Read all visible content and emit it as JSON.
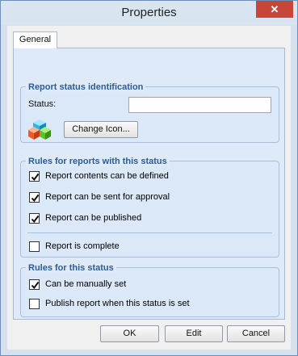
{
  "window": {
    "title": "Properties",
    "close_glyph": "✕"
  },
  "tabs": [
    {
      "label": "General",
      "selected": true
    }
  ],
  "group_identification": {
    "title": "Report status identification",
    "status_label": "Status:",
    "status_value": "",
    "icon": "colored-cubes-icon",
    "change_icon_label": "Change Icon..."
  },
  "group_report_rules": {
    "title": "Rules for reports with this status",
    "items": [
      {
        "label": "Report contents can be defined",
        "checked": true
      },
      {
        "label": "Report can be sent for approval",
        "checked": true
      },
      {
        "label": "Report can be published",
        "checked": true
      },
      {
        "label": "Report is complete",
        "checked": false
      }
    ]
  },
  "group_status_rules": {
    "title": "Rules for this status",
    "items": [
      {
        "label": "Can be manually set",
        "checked": true
      },
      {
        "label": "Publish report when this status is set",
        "checked": false
      }
    ]
  },
  "buttons": {
    "ok": "OK",
    "edit": "Edit",
    "cancel": "Cancel"
  }
}
